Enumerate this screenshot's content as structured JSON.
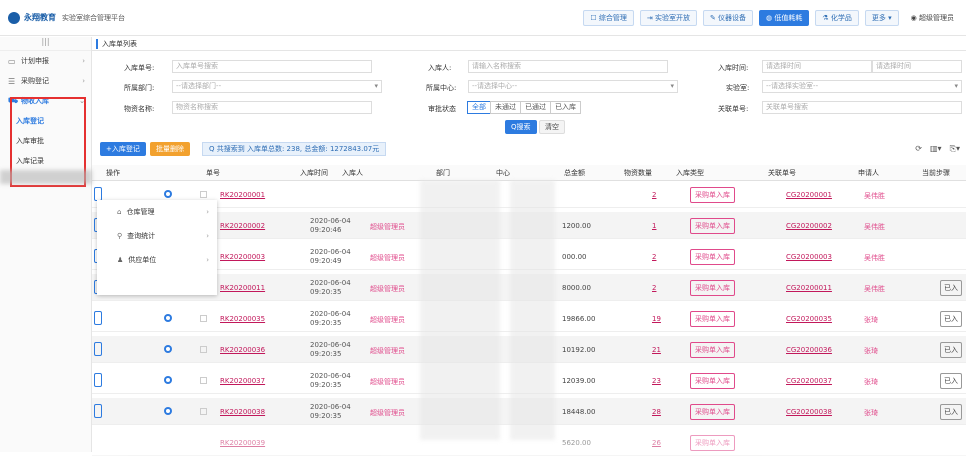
{
  "header": {
    "logo_text": "永翔教育",
    "subtitle": "实验室综合管理平台",
    "nav": [
      "综合管理",
      "实验室开放",
      "仪器设备",
      "低值耗耗",
      "化学品",
      "更多",
      "超级管理员"
    ],
    "active_index": 3
  },
  "sidebar": {
    "toggle": "|||",
    "items": [
      {
        "label": "计划申报",
        "icon": "monitor-icon"
      },
      {
        "label": "采购登记",
        "icon": "list-icon"
      },
      {
        "label": "物收入库",
        "icon": "cart-icon"
      }
    ],
    "sub_items": [
      "入库登记",
      "入库审批",
      "入库记录"
    ]
  },
  "tab": {
    "label": "入库单列表"
  },
  "filters": {
    "order_no": {
      "label": "入库单号:",
      "placeholder": "入库单号搜索"
    },
    "dept": {
      "label": "所属部门:",
      "placeholder": "--请选择部门--"
    },
    "item_name": {
      "label": "物资名称:",
      "placeholder": "物资名称搜索"
    },
    "inbound_person": {
      "label": "入库人:",
      "placeholder": "请输入名称搜索"
    },
    "center": {
      "label": "所属中心:",
      "placeholder": "--请选择中心--"
    },
    "approval_status": {
      "label": "审批状态",
      "options": [
        "全部",
        "未通过",
        "已通过",
        "已入库"
      ],
      "selected": "全部"
    },
    "inbound_time": {
      "label": "入库时间:",
      "placeholder_start": "请选择时间",
      "placeholder_end": "请选择时间"
    },
    "lab": {
      "label": "实验室:",
      "placeholder": "--请选择实验室--"
    },
    "related_no": {
      "label": "关联单号:",
      "placeholder": "关联单号搜索"
    },
    "search_btn": "Q搜索",
    "clear_btn": "清空"
  },
  "actions": {
    "add_btn": "+入库登记",
    "batch_delete_btn": "批量删除",
    "summary": "Q 共搜索到 入库单总数: 238, 总金额: 1272843.07元"
  },
  "table": {
    "columns": [
      "操作",
      "单号",
      "入库时间",
      "入库人",
      "部门",
      "中心",
      "总金额",
      "物资数量",
      "入库类型",
      "关联单号",
      "申请人",
      "当前步骤"
    ],
    "rows": [
      {
        "id": "RK20200001",
        "time": "",
        "user": "",
        "amount": "",
        "qty": "2",
        "type": "采购单入库",
        "po": "CG20200001",
        "req": "吴伟胜",
        "state": ""
      },
      {
        "id": "RK20200002",
        "time": "2020-06-04 09:20:46",
        "user": "超级管理员",
        "amount": "1200.00",
        "qty": "1",
        "type": "采购单入库",
        "po": "CG20200002",
        "req": "吴伟胜",
        "state": ""
      },
      {
        "id": "RK20200003",
        "time": "2020-06-04 09:20:49",
        "user": "超级管理员",
        "amount": "000.00",
        "qty": "2",
        "type": "采购单入库",
        "po": "CG20200003",
        "req": "吴伟胜",
        "state": ""
      },
      {
        "id": "RK20200011",
        "time": "2020-06-04 09:20:35",
        "user": "超级管理员",
        "amount": "8000.00",
        "qty": "2",
        "type": "采购单入库",
        "po": "CG20200011",
        "req": "吴伟胜",
        "state": "已入"
      },
      {
        "id": "RK20200035",
        "time": "2020-06-04 09:20:35",
        "user": "超级管理员",
        "amount": "19866.00",
        "qty": "19",
        "type": "采购单入库",
        "po": "CG20200035",
        "req": "张琦",
        "state": "已入"
      },
      {
        "id": "RK20200036",
        "time": "2020-06-04 09:20:35",
        "user": "超级管理员",
        "amount": "10192.00",
        "qty": "21",
        "type": "采购单入库",
        "po": "CG20200036",
        "req": "张琦",
        "state": "已入"
      },
      {
        "id": "RK20200037",
        "time": "2020-06-04 09:20:35",
        "user": "超级管理员",
        "amount": "12039.00",
        "qty": "23",
        "type": "采购单入库",
        "po": "CG20200037",
        "req": "张琦",
        "state": "已入"
      },
      {
        "id": "RK20200038",
        "time": "2020-06-04 09:20:35",
        "user": "超级管理员",
        "amount": "18448.00",
        "qty": "28",
        "type": "采购单入库",
        "po": "CG20200038",
        "req": "张琦",
        "state": "已入"
      }
    ],
    "ghost_row": {
      "id": "RK20200039",
      "amount": "5620.00",
      "qty": "26",
      "type": "采购单入库"
    }
  },
  "popup_menu": [
    {
      "label": "仓库管理",
      "icon": "home-icon"
    },
    {
      "label": "查询统计",
      "icon": "search-icon"
    },
    {
      "label": "供应单位",
      "icon": "user-icon"
    }
  ]
}
